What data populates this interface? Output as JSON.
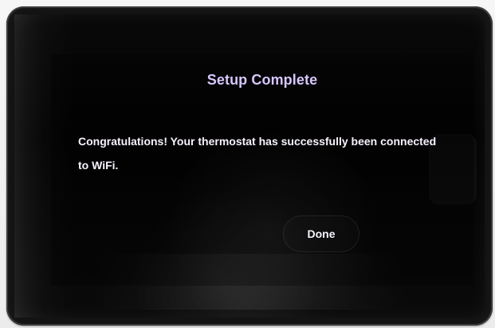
{
  "theme": {
    "title_color": "#d7c7ff",
    "body_color": "#f7f2ff",
    "button_text_color": "#f8f4ff"
  },
  "dialog": {
    "title": "Setup Complete",
    "message": "Congratulations! Your thermostat has successfully been connected to WiFi.",
    "button_label": "Done"
  }
}
